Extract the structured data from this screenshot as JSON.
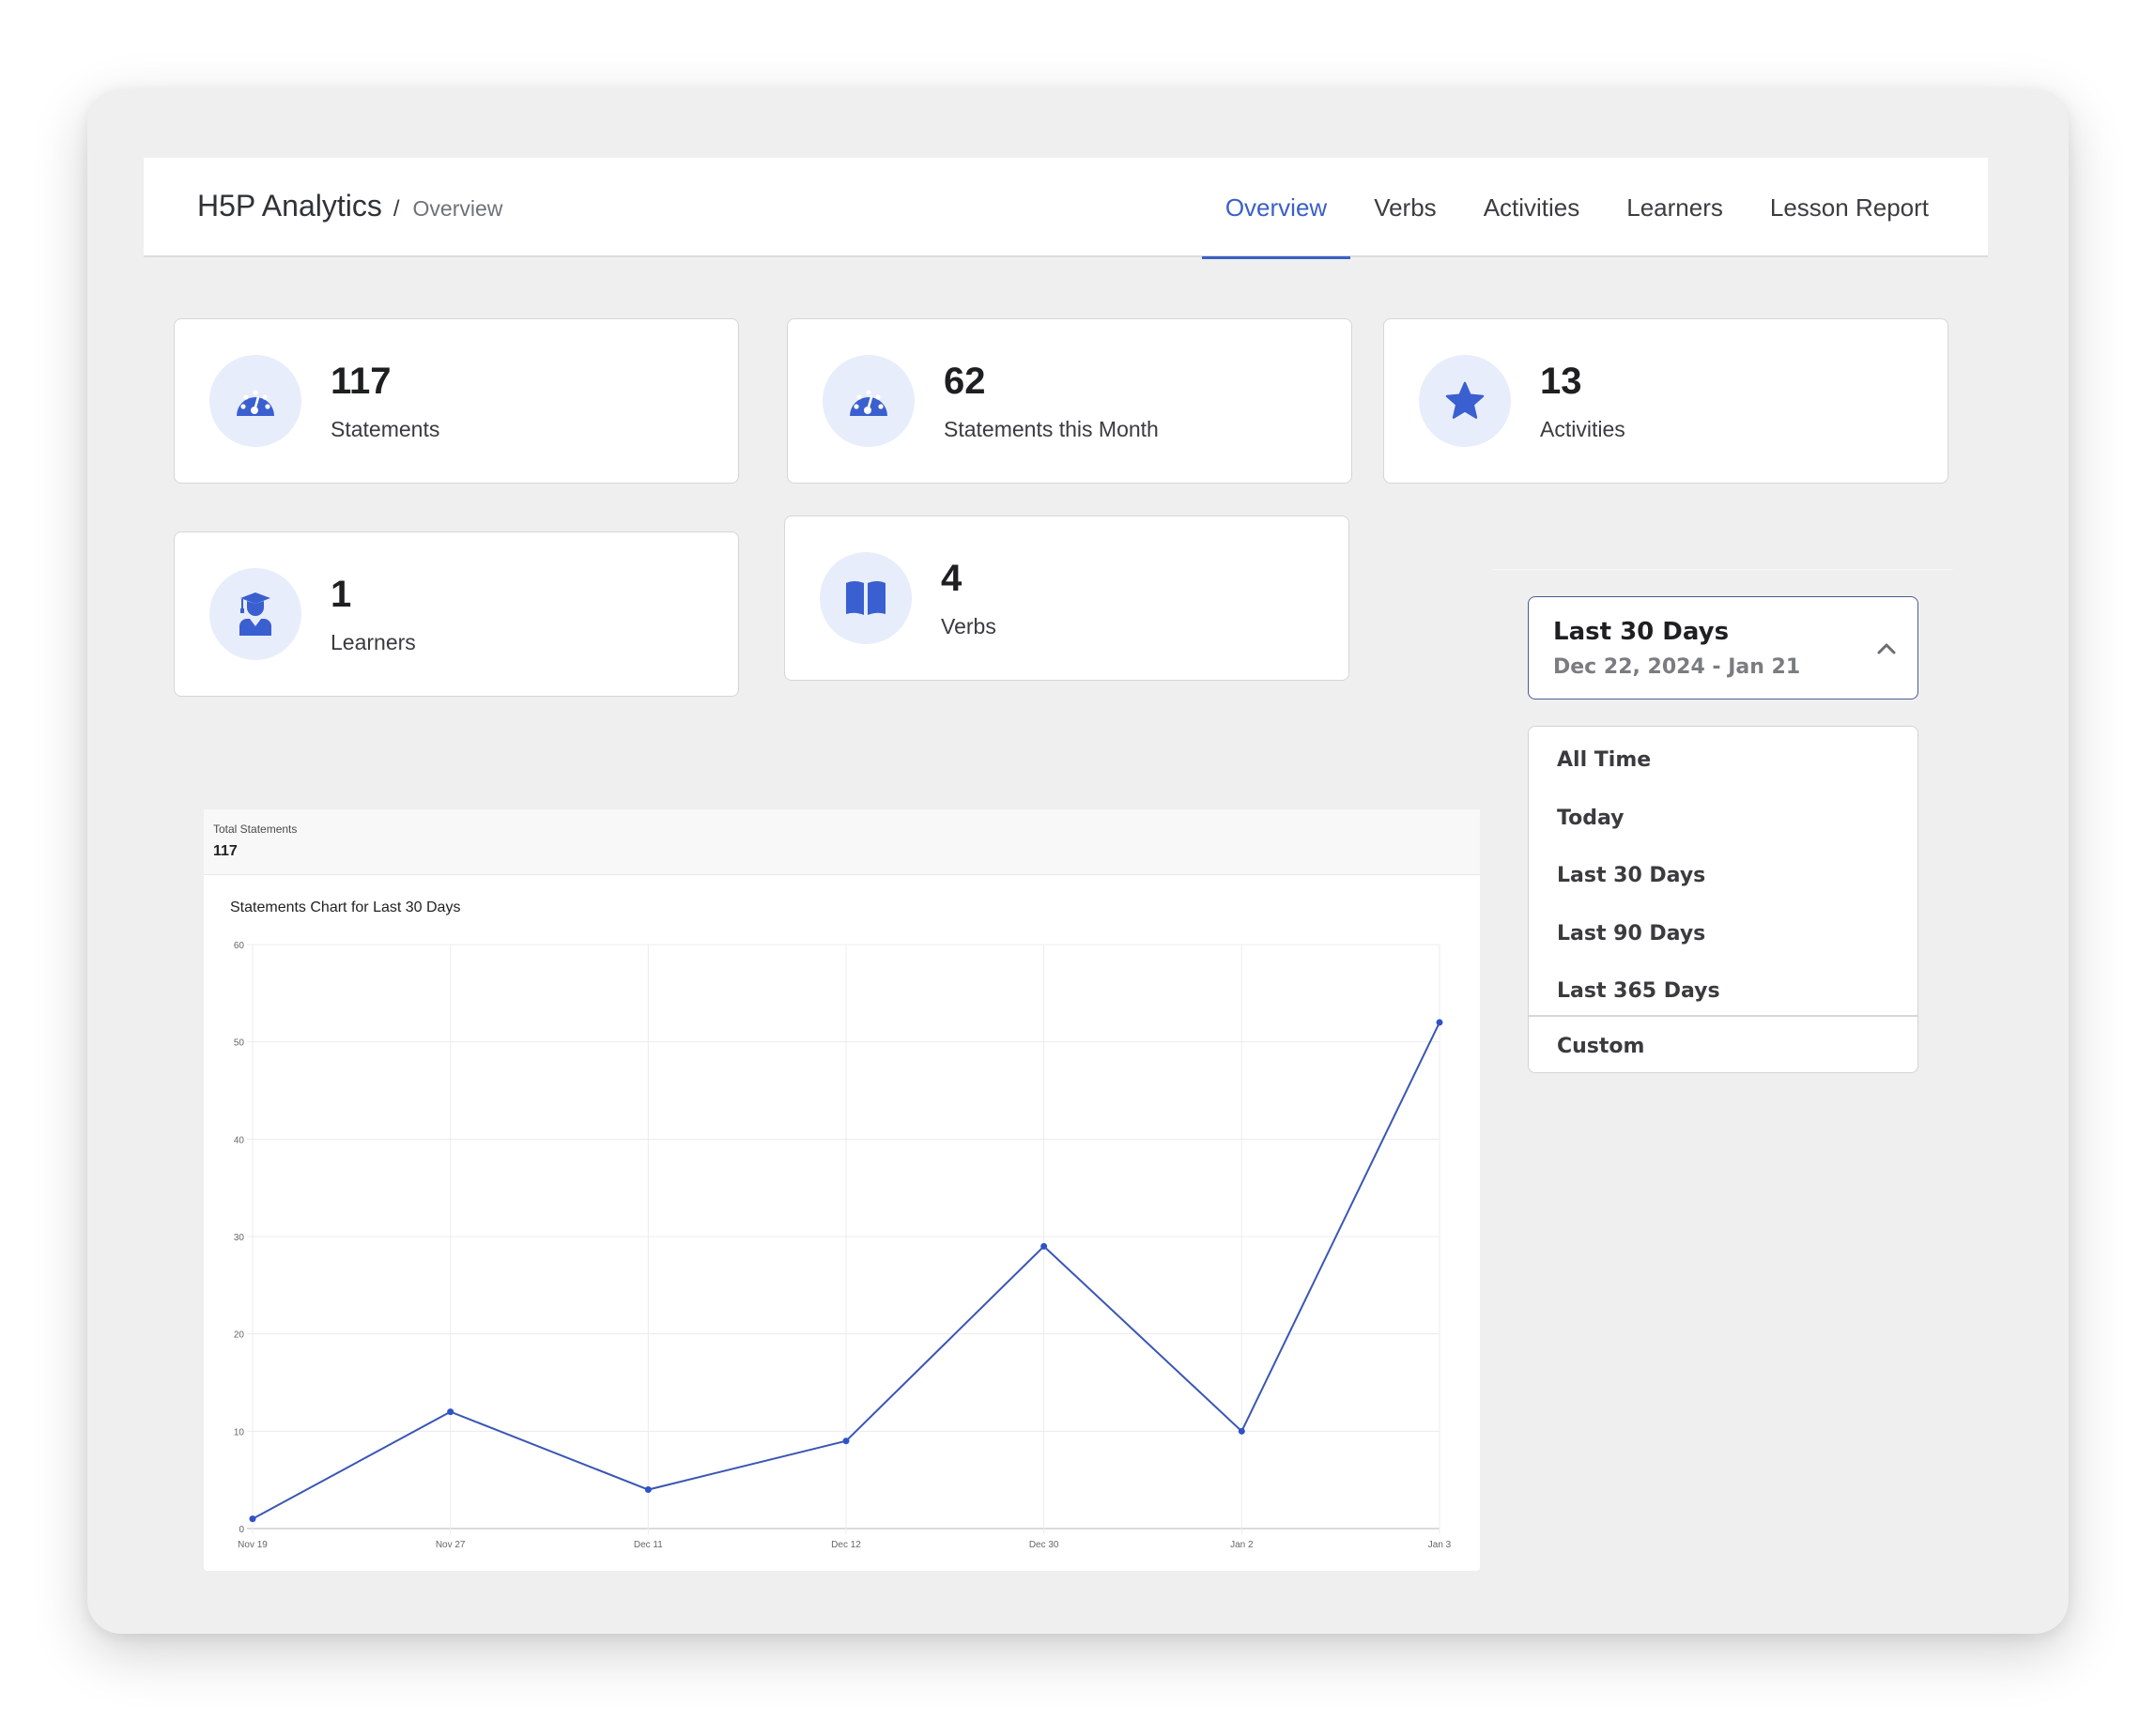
{
  "header": {
    "app_title": "H5P Analytics",
    "separator": "/",
    "breadcrumb": "Overview",
    "tabs": [
      {
        "label": "Overview",
        "active": true
      },
      {
        "label": "Verbs",
        "active": false
      },
      {
        "label": "Activities",
        "active": false
      },
      {
        "label": "Learners",
        "active": false
      },
      {
        "label": "Lesson Report",
        "active": false
      }
    ]
  },
  "stats": [
    {
      "value": "117",
      "label": "Statements",
      "icon": "dashboard-gauge-icon"
    },
    {
      "value": "62",
      "label": "Statements this Month",
      "icon": "dashboard-gauge-icon"
    },
    {
      "value": "13",
      "label": "Activities",
      "icon": "star-icon"
    },
    {
      "value": "1",
      "label": "Learners",
      "icon": "graduate-user-icon"
    },
    {
      "value": "4",
      "label": "Verbs",
      "icon": "open-book-icon"
    }
  ],
  "date_range": {
    "selected_label": "Last 30 Days",
    "selected_range": "Dec 22, 2024 - Jan 21",
    "expanded": true,
    "options": [
      "All Time",
      "Today",
      "Last 30 Days",
      "Last 90 Days",
      "Last 365 Days",
      "Custom"
    ]
  },
  "summary": {
    "label": "Total Statements",
    "value": "117"
  },
  "colors": {
    "accent": "#3a5fc7",
    "icon_bg": "#e8edfb",
    "line": "#3a56b4"
  },
  "chart_data": {
    "type": "line",
    "title": "Statements Chart for Last 30 Days",
    "xlabel": "",
    "ylabel": "",
    "categories": [
      "Nov 19",
      "Nov 27",
      "Dec 11",
      "Dec 12",
      "Dec 30",
      "Jan 2",
      "Jan 3"
    ],
    "series": [
      {
        "name": "Statements",
        "values": [
          1,
          12,
          4,
          9,
          29,
          10,
          52
        ]
      }
    ],
    "ylim": [
      0,
      60
    ],
    "yticks": [
      0,
      10,
      20,
      30,
      40,
      50,
      60
    ],
    "grid": true,
    "legend": "none"
  }
}
